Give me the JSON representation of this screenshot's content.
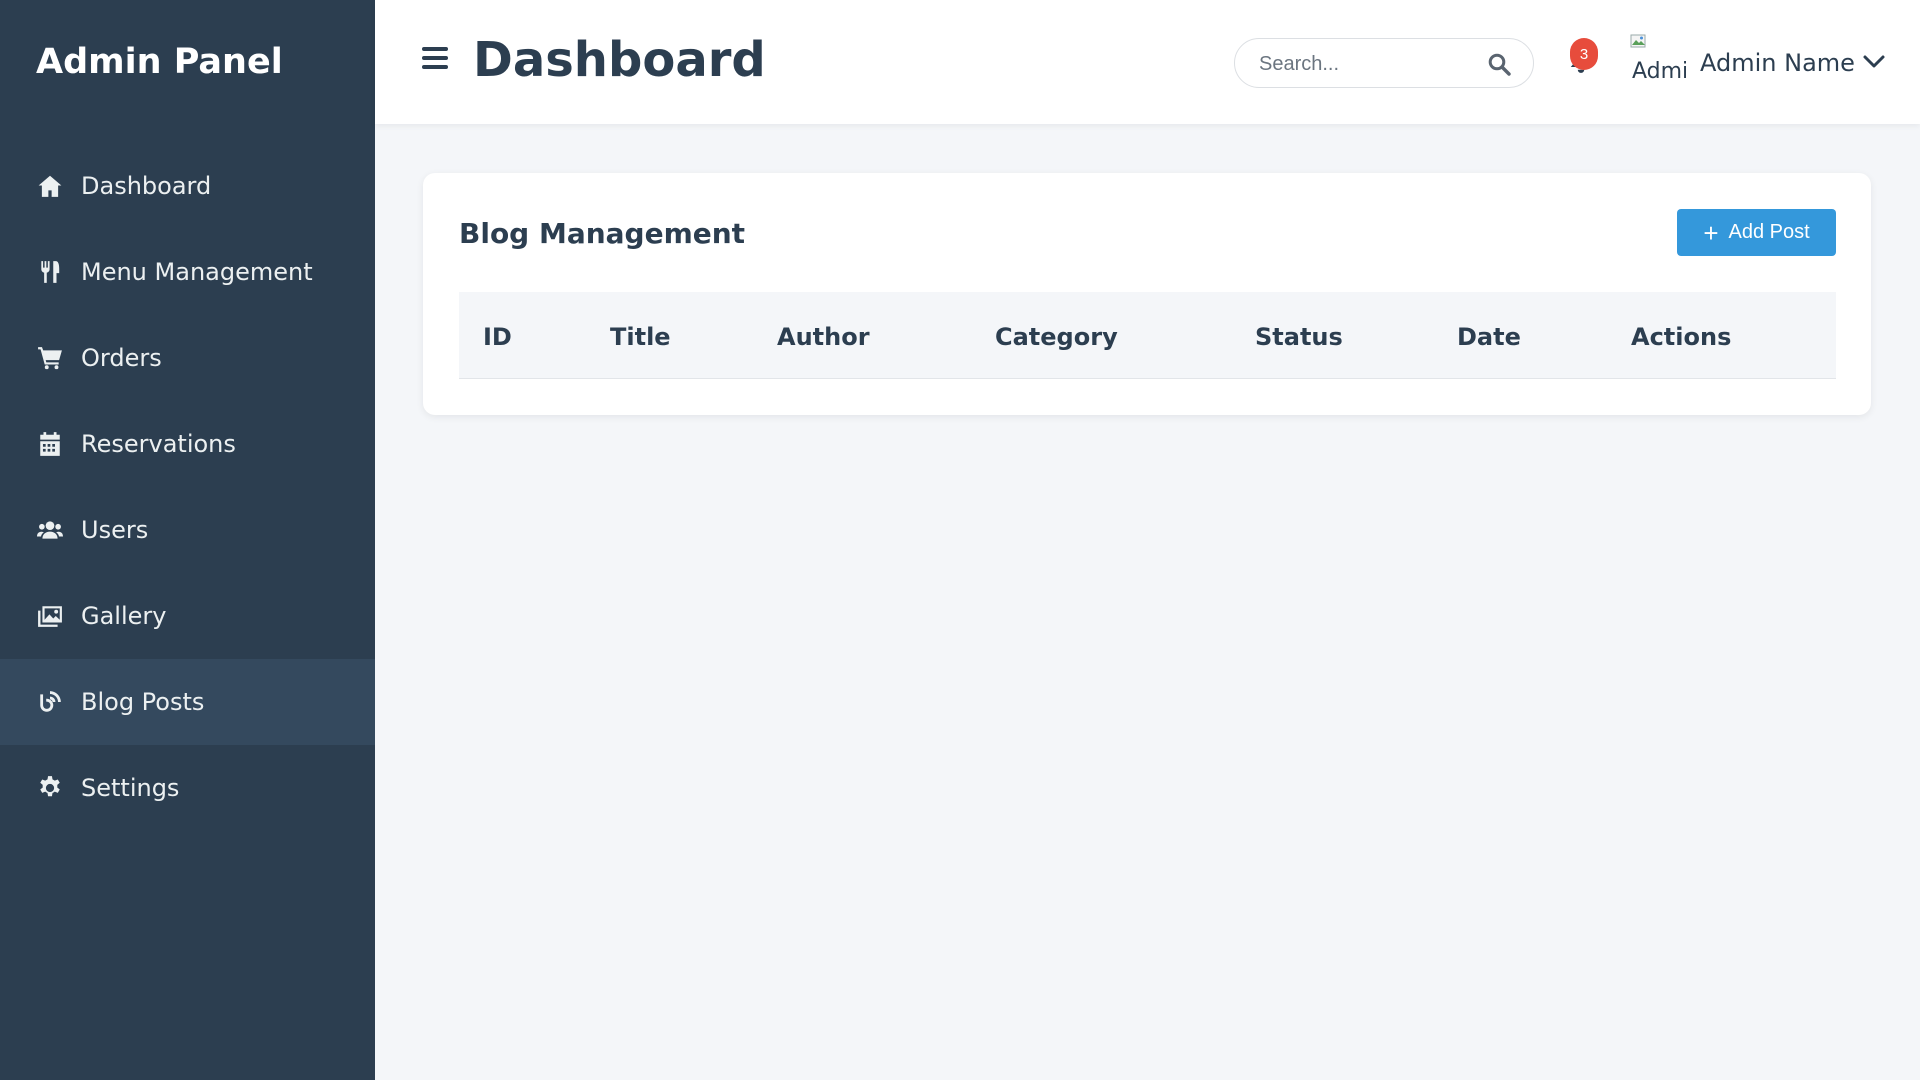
{
  "sidebar": {
    "brand": "Admin Panel",
    "items": [
      {
        "label": "Dashboard",
        "icon": "home-icon",
        "active": false
      },
      {
        "label": "Menu Management",
        "icon": "utensils-icon",
        "active": false
      },
      {
        "label": "Orders",
        "icon": "shopping-cart-icon",
        "active": false
      },
      {
        "label": "Reservations",
        "icon": "calendar-icon",
        "active": false
      },
      {
        "label": "Users",
        "icon": "users-icon",
        "active": false
      },
      {
        "label": "Gallery",
        "icon": "images-icon",
        "active": false
      },
      {
        "label": "Blog Posts",
        "icon": "blog-icon",
        "active": true
      },
      {
        "label": "Settings",
        "icon": "gear-icon",
        "active": false
      }
    ]
  },
  "header": {
    "title": "Dashboard",
    "search": {
      "placeholder": "Search...",
      "value": ""
    },
    "notifications_count": "3",
    "avatar_alt": "Admin",
    "user_name": "Admin Name"
  },
  "blog": {
    "title": "Blog Management",
    "add_button": "Add Post",
    "columns": [
      "ID",
      "Title",
      "Author",
      "Category",
      "Status",
      "Date",
      "Actions"
    ],
    "rows": []
  },
  "colors": {
    "sidebar_bg": "#2c3e50",
    "sidebar_active": "#34495e",
    "accent": "#3498db",
    "badge": "#e74c3c",
    "page_bg": "#f4f6f9"
  }
}
